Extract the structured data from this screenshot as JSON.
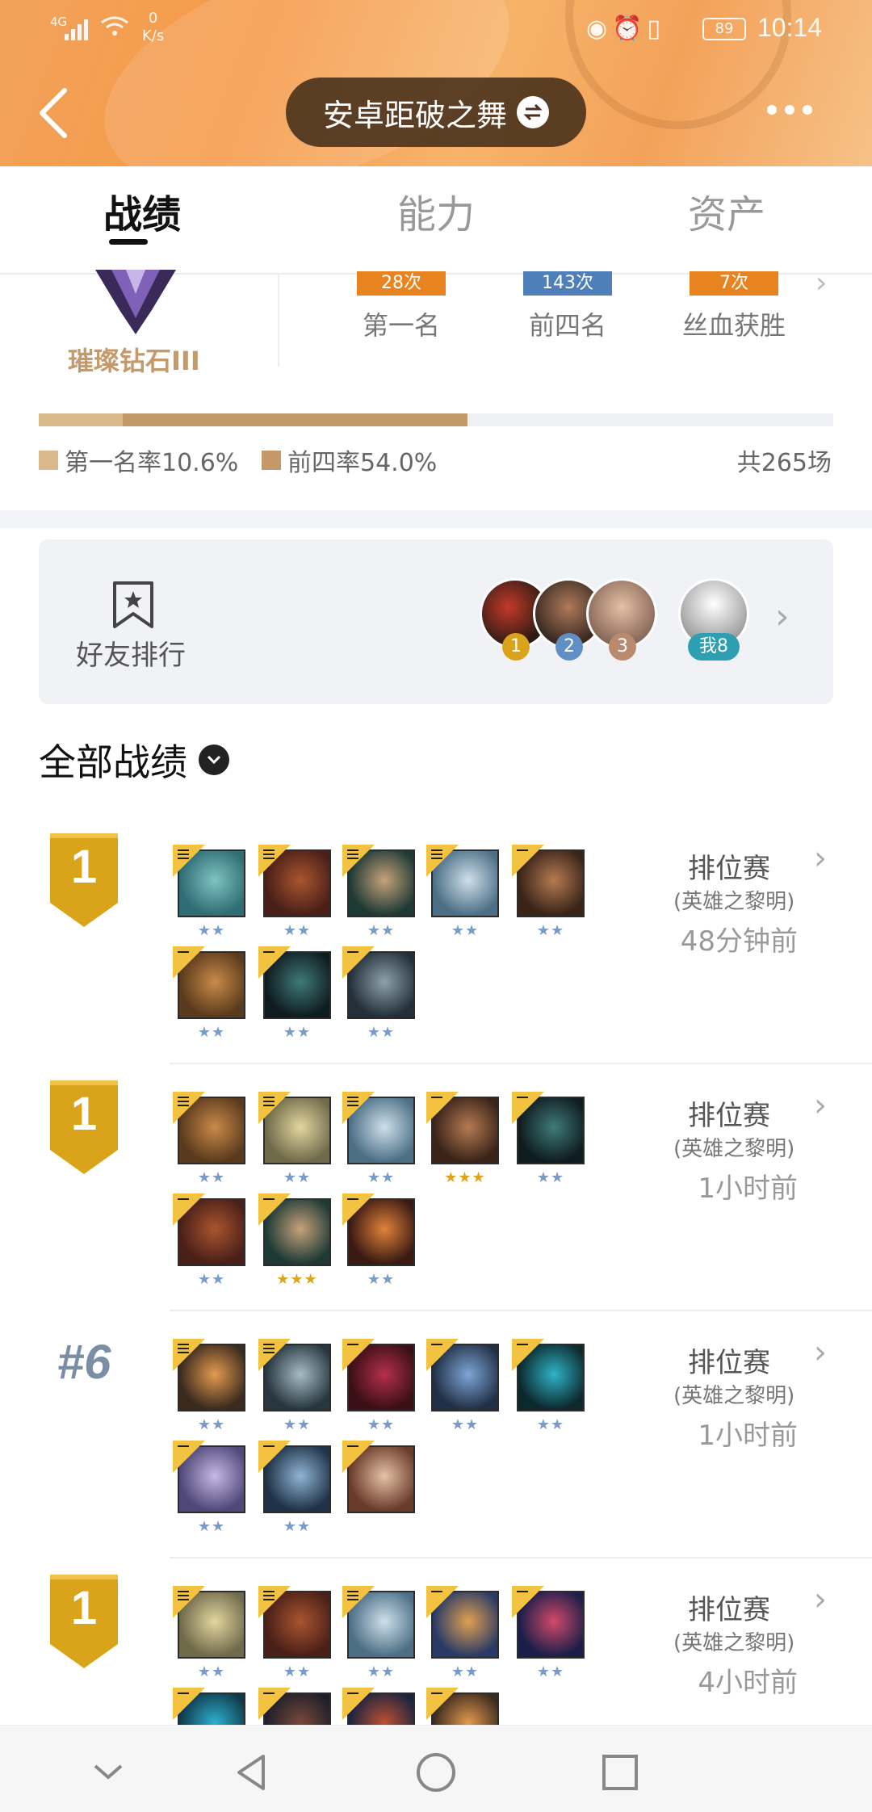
{
  "status_bar": {
    "network": "4G",
    "speed_value": "0",
    "speed_unit": "K/s",
    "battery": "89",
    "time": "10:14"
  },
  "header": {
    "title": "安卓距破之舞"
  },
  "tabs": [
    {
      "label": "战绩",
      "active": true
    },
    {
      "label": "能力",
      "active": false
    },
    {
      "label": "资产",
      "active": false
    }
  ],
  "rank": {
    "tier": "璀璨钻石III",
    "stats": [
      {
        "count": "28次",
        "label": "第一名",
        "color": "#e8841f"
      },
      {
        "count": "143次",
        "label": "前四名",
        "color": "#4f7fba"
      },
      {
        "count": "7次",
        "label": "丝血获胜",
        "color": "#e8841f"
      }
    ],
    "first_rate": 0.106,
    "top4_rate": 0.54,
    "first_rate_label": "第一名率10.6%",
    "top4_rate_label": "前四率54.0%",
    "total_games": "共265场",
    "colors": {
      "first": "#d9b98b",
      "top4": "#c4996a"
    }
  },
  "friends": {
    "label": "好友排行",
    "ranks": [
      "1",
      "2",
      "3"
    ],
    "rank_colors": [
      "#d9a31a",
      "#5f8fc4",
      "#b98a6e"
    ],
    "me_label": "我8"
  },
  "records": {
    "title": "全部战绩",
    "matches": [
      {
        "place": "1",
        "is_top": true,
        "mode": "排位赛",
        "sub": "(英雄之黎明)",
        "ago": "48分钟前",
        "champions": [
          {
            "stars": 2,
            "gold": false,
            "tag": "3",
            "palette": [
              "#2f6c74",
              "#7fc4c2"
            ]
          },
          {
            "stars": 2,
            "gold": false,
            "tag": "3",
            "palette": [
              "#4a1f18",
              "#a9552f"
            ]
          },
          {
            "stars": 2,
            "gold": false,
            "tag": "3",
            "palette": [
              "#1d3a35",
              "#c7a27a"
            ]
          },
          {
            "stars": 2,
            "gold": false,
            "tag": "3",
            "palette": [
              "#4c6f86",
              "#cfe0ea"
            ]
          },
          {
            "stars": 2,
            "gold": false,
            "tag": "1",
            "palette": [
              "#3a2418",
              "#b57a52"
            ]
          },
          {
            "stars": 2,
            "gold": false,
            "tag": "1",
            "palette": [
              "#5a3a1c",
              "#c98a4a"
            ]
          },
          {
            "stars": 2,
            "gold": false,
            "tag": "0",
            "palette": [
              "#0f1c1f",
              "#3f7a7a"
            ]
          },
          {
            "stars": 2,
            "gold": false,
            "tag": "0",
            "palette": [
              "#23303a",
              "#8ea1ad"
            ]
          }
        ]
      },
      {
        "place": "1",
        "is_top": true,
        "mode": "排位赛",
        "sub": "(英雄之黎明)",
        "ago": "1小时前",
        "champions": [
          {
            "stars": 2,
            "gold": false,
            "tag": "3",
            "palette": [
              "#5a3a1c",
              "#c98a4a"
            ]
          },
          {
            "stars": 2,
            "gold": false,
            "tag": "3",
            "palette": [
              "#6f6a4a",
              "#e4d6a0"
            ]
          },
          {
            "stars": 2,
            "gold": false,
            "tag": "3",
            "palette": [
              "#4c6f86",
              "#cfe0ea"
            ]
          },
          {
            "stars": 3,
            "gold": true,
            "tag": "1",
            "palette": [
              "#3a2418",
              "#b57a52"
            ]
          },
          {
            "stars": 2,
            "gold": false,
            "tag": "1",
            "palette": [
              "#0f1c1f",
              "#3f7a7a"
            ]
          },
          {
            "stars": 2,
            "gold": false,
            "tag": "1",
            "palette": [
              "#4a1f18",
              "#a9552f"
            ]
          },
          {
            "stars": 3,
            "gold": true,
            "tag": "0",
            "palette": [
              "#1d3a35",
              "#c7a27a"
            ]
          },
          {
            "stars": 2,
            "gold": false,
            "tag": "0",
            "palette": [
              "#3b1a12",
              "#e0823a"
            ]
          }
        ]
      },
      {
        "place": "#6",
        "is_top": false,
        "mode": "排位赛",
        "sub": "(英雄之黎明)",
        "ago": "1小时前",
        "champions": [
          {
            "stars": 2,
            "gold": false,
            "tag": "3",
            "palette": [
              "#3b2a1e",
              "#e39a4f"
            ]
          },
          {
            "stars": 2,
            "gold": false,
            "tag": "3",
            "palette": [
              "#27363f",
              "#a7bcc6"
            ]
          },
          {
            "stars": 2,
            "gold": false,
            "tag": "1",
            "palette": [
              "#3a0f16",
              "#b3304a"
            ]
          },
          {
            "stars": 2,
            "gold": false,
            "tag": "1",
            "palette": [
              "#223047",
              "#7da6d6"
            ]
          },
          {
            "stars": 2,
            "gold": false,
            "tag": "1",
            "palette": [
              "#0c2a2e",
              "#2fb3c7"
            ]
          },
          {
            "stars": 2,
            "gold": false,
            "tag": "0",
            "palette": [
              "#4f4878",
              "#c7b8e6"
            ]
          },
          {
            "stars": 2,
            "gold": false,
            "tag": "0",
            "palette": [
              "#1f3247",
              "#8fb4d4"
            ]
          },
          {
            "stars": 0,
            "gold": false,
            "tag": "0",
            "palette": [
              "#6a3a2a",
              "#e6c2a6"
            ]
          }
        ]
      },
      {
        "place": "1",
        "is_top": true,
        "mode": "排位赛",
        "sub": "(英雄之黎明)",
        "ago": "4小时前",
        "champions": [
          {
            "stars": 2,
            "gold": false,
            "tag": "3",
            "palette": [
              "#6f6a4a",
              "#e4d6a0"
            ]
          },
          {
            "stars": 2,
            "gold": false,
            "tag": "3",
            "palette": [
              "#4a1f18",
              "#a9552f"
            ]
          },
          {
            "stars": 2,
            "gold": false,
            "tag": "3",
            "palette": [
              "#4c6f86",
              "#cfe0ea"
            ]
          },
          {
            "stars": 2,
            "gold": false,
            "tag": "1",
            "palette": [
              "#2a3a66",
              "#e0a050"
            ]
          },
          {
            "stars": 2,
            "gold": false,
            "tag": "1",
            "palette": [
              "#1c1e4a",
              "#d04a6a"
            ]
          },
          {
            "stars": 0,
            "gold": false,
            "tag": "1",
            "palette": [
              "#0f3a4a",
              "#2fb0d0"
            ]
          },
          {
            "stars": 0,
            "gold": false,
            "tag": "1",
            "palette": [
              "#1e1e2a",
              "#7a4a3a"
            ]
          },
          {
            "stars": 0,
            "gold": false,
            "tag": "0",
            "palette": [
              "#1a2440",
              "#c05030"
            ]
          },
          {
            "stars": 0,
            "gold": false,
            "tag": "0",
            "palette": [
              "#3b2a1e",
              "#e39a4f"
            ]
          }
        ]
      }
    ]
  }
}
